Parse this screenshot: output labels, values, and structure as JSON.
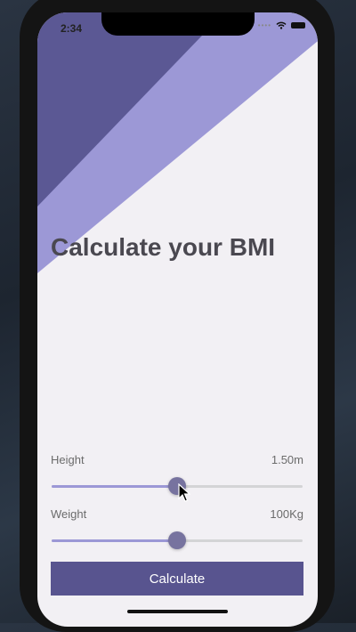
{
  "status_bar": {
    "time": "2:34"
  },
  "main": {
    "title": "Calculate your BMI"
  },
  "height": {
    "label": "Height",
    "value": "1.50m",
    "fraction": 0.5
  },
  "weight": {
    "label": "Weight",
    "value": "100Kg",
    "fraction": 0.5
  },
  "button": {
    "label": "Calculate"
  },
  "colors": {
    "dark": "#58548f",
    "light": "#9c98d6",
    "background": "#f2f0f4"
  }
}
